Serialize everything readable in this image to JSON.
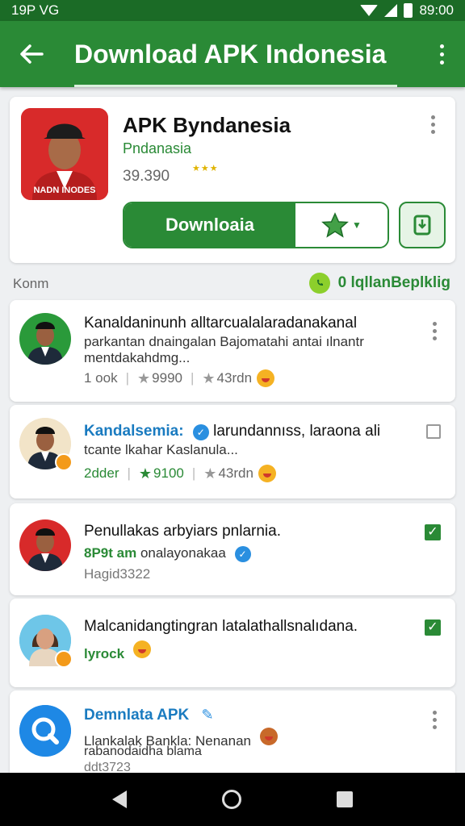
{
  "status": {
    "left_text": "19P VG",
    "time": "89:00"
  },
  "app_bar": {
    "title": "Download APK Indonesia"
  },
  "hero": {
    "name": "APK Byndanesia",
    "developer": "Pndanasia",
    "count": "39.390",
    "stars": "★★★",
    "icon_label": "NADN INODES",
    "download_label": "Downloaia"
  },
  "section": {
    "left_label": "Konm",
    "right_label": "0 lqllanBeplklig"
  },
  "items": [
    {
      "title": "Kanaldaninunh alltarcualalaradanakanal",
      "line1": "parkantan dnaingalan Bajomatahi antai ılnantr",
      "line2": "mentdakahdmg...",
      "meta1": "1 ook",
      "meta2": "9990",
      "meta3": "43rdn"
    },
    {
      "title": "Kandalsemia:",
      "title_rest": "larundannıss, laraona ali",
      "line1": "tcante lkahar Kaslanula...",
      "meta1": "2dder",
      "meta2": "9100",
      "meta3": "43rdn"
    },
    {
      "title": "Penullakas arbyiars pnlarnia.",
      "line1_green": "8P9t am",
      "line1_rest": "onalayonakaa",
      "line2": "Hagid3322"
    },
    {
      "title": "Malcanidangtingran latalathallsnalıdana.",
      "line1_green": "lyrock"
    },
    {
      "title": "Demnlata APK",
      "line1": "Llankalak Bankla: Nenanan",
      "line2": "rabanodaidha blama",
      "line3": "ddt3723"
    }
  ],
  "colors": {
    "primary": "#2a8a36",
    "status_bar": "#1b6b26",
    "accent_blue": "#1a7bc0",
    "hero_icon_bg": "#d82a2a"
  }
}
